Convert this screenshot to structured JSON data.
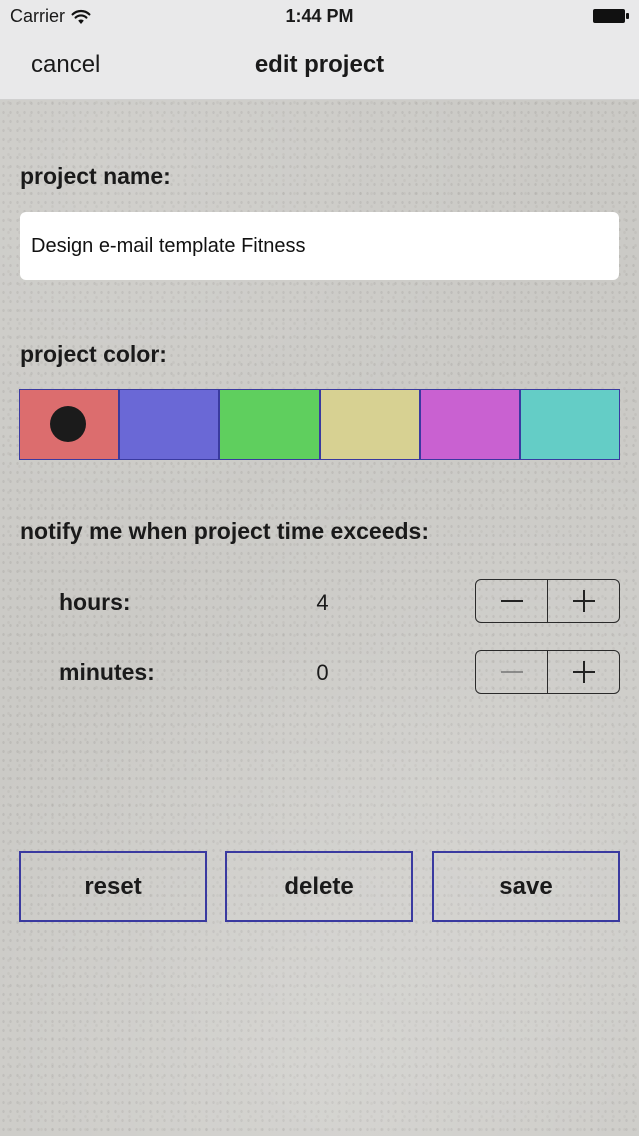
{
  "status_bar": {
    "carrier": "Carrier",
    "time": "1:44 PM"
  },
  "nav": {
    "cancel_label": "cancel",
    "title": "edit project"
  },
  "form": {
    "name_label": "project name:",
    "name_value": "Design e-mail template Fitness",
    "color_label": "project color:",
    "colors": [
      {
        "name": "red",
        "hex": "#dc6d6e",
        "selected": true
      },
      {
        "name": "blue",
        "hex": "#6a68d6",
        "selected": false
      },
      {
        "name": "green",
        "hex": "#5fcf5e",
        "selected": false
      },
      {
        "name": "yellow",
        "hex": "#d7d192",
        "selected": false
      },
      {
        "name": "magenta",
        "hex": "#c961d1",
        "selected": false
      },
      {
        "name": "teal",
        "hex": "#64cdc6",
        "selected": false
      }
    ],
    "notify_label": "notify me when project time exceeds:",
    "hours_label": "hours:",
    "hours_value": "4",
    "minutes_label": "minutes:",
    "minutes_value": "0"
  },
  "actions": {
    "reset_label": "reset",
    "delete_label": "delete",
    "save_label": "save"
  },
  "theme": {
    "accent_border": "#3a3aa0",
    "nav_background": "#e9e9ea"
  }
}
